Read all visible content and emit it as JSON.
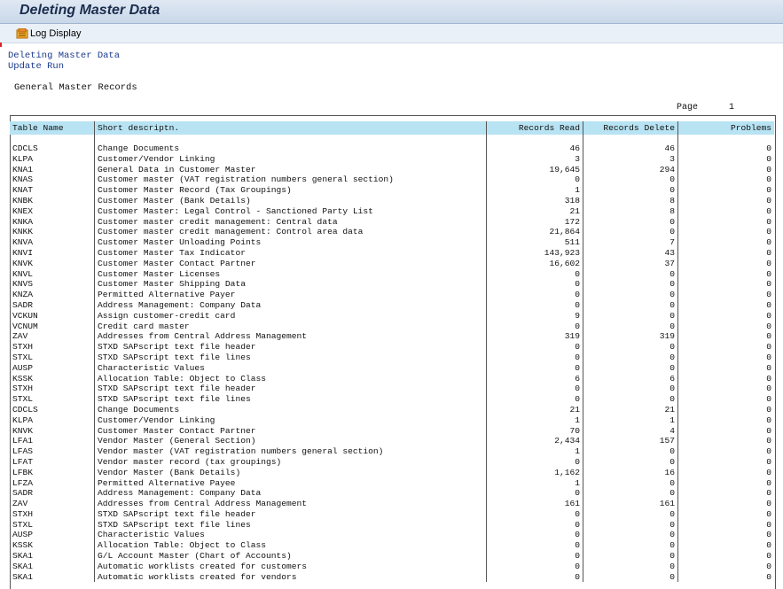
{
  "title": "Deleting Master Data",
  "toolbar": {
    "log_display": "Log Display"
  },
  "header_lines": [
    "Deleting Master Data",
    "Update Run"
  ],
  "section": "General Master Records",
  "page_label": "Page",
  "page_number": "1",
  "columns": [
    "Table Name",
    "Short descriptn.",
    "Records Read",
    "Records Delete",
    "Problems"
  ],
  "rows": [
    [
      "CDCLS",
      "Change Documents",
      "46",
      "46",
      "0"
    ],
    [
      "KLPA",
      "Customer/Vendor Linking",
      "3",
      "3",
      "0"
    ],
    [
      "KNA1",
      "General Data in Customer Master",
      "19,645",
      "294",
      "0"
    ],
    [
      "KNAS",
      "Customer master (VAT registration numbers general section)",
      "0",
      "0",
      "0"
    ],
    [
      "KNAT",
      "Customer Master Record (Tax Groupings)",
      "1",
      "0",
      "0"
    ],
    [
      "KNBK",
      "Customer Master (Bank Details)",
      "318",
      "8",
      "0"
    ],
    [
      "KNEX",
      "Customer Master: Legal Control - Sanctioned Party List",
      "21",
      "8",
      "0"
    ],
    [
      "KNKA",
      "Customer master credit management: Central data",
      "172",
      "0",
      "0"
    ],
    [
      "KNKK",
      "Customer master credit management: Control area data",
      "21,864",
      "0",
      "0"
    ],
    [
      "KNVA",
      "Customer Master Unloading Points",
      "511",
      "7",
      "0"
    ],
    [
      "KNVI",
      "Customer Master Tax Indicator",
      "143,923",
      "43",
      "0"
    ],
    [
      "KNVK",
      "Customer Master Contact Partner",
      "16,602",
      "37",
      "0"
    ],
    [
      "KNVL",
      "Customer Master Licenses",
      "0",
      "0",
      "0"
    ],
    [
      "KNVS",
      "Customer Master Shipping Data",
      "0",
      "0",
      "0"
    ],
    [
      "KNZA",
      "Permitted Alternative Payer",
      "0",
      "0",
      "0"
    ],
    [
      "SADR",
      "Address Management: Company Data",
      "0",
      "0",
      "0"
    ],
    [
      "VCKUN",
      "Assign customer-credit card",
      "9",
      "0",
      "0"
    ],
    [
      "VCNUM",
      "Credit card master",
      "0",
      "0",
      "0"
    ],
    [
      "ZAV",
      "Addresses from Central Address Management",
      "319",
      "319",
      "0"
    ],
    [
      "STXH",
      "STXD SAPscript text file header",
      "0",
      "0",
      "0"
    ],
    [
      "STXL",
      "STXD SAPscript text file lines",
      "0",
      "0",
      "0"
    ],
    [
      "AUSP",
      "Characteristic Values",
      "0",
      "0",
      "0"
    ],
    [
      "KSSK",
      "Allocation Table: Object to Class",
      "6",
      "6",
      "0"
    ],
    [
      "STXH",
      "STXD SAPscript text file header",
      "0",
      "0",
      "0"
    ],
    [
      "STXL",
      "STXD SAPscript text file lines",
      "0",
      "0",
      "0"
    ],
    [
      "CDCLS",
      "Change Documents",
      "21",
      "21",
      "0"
    ],
    [
      "KLPA",
      "Customer/Vendor Linking",
      "1",
      "1",
      "0"
    ],
    [
      "KNVK",
      "Customer Master Contact Partner",
      "70",
      "4",
      "0"
    ],
    [
      "LFA1",
      "Vendor Master (General Section)",
      "2,434",
      "157",
      "0"
    ],
    [
      "LFAS",
      "Vendor master (VAT registration numbers general section)",
      "1",
      "0",
      "0"
    ],
    [
      "LFAT",
      "Vendor master record  (tax groupings)",
      "0",
      "0",
      "0"
    ],
    [
      "LFBK",
      "Vendor Master (Bank Details)",
      "1,162",
      "16",
      "0"
    ],
    [
      "LFZA",
      "Permitted Alternative Payee",
      "1",
      "0",
      "0"
    ],
    [
      "SADR",
      "Address Management: Company Data",
      "0",
      "0",
      "0"
    ],
    [
      "ZAV",
      "Addresses from Central Address Management",
      "161",
      "161",
      "0"
    ],
    [
      "STXH",
      "STXD SAPscript text file header",
      "0",
      "0",
      "0"
    ],
    [
      "STXL",
      "STXD SAPscript text file lines",
      "0",
      "0",
      "0"
    ],
    [
      "AUSP",
      "Characteristic Values",
      "0",
      "0",
      "0"
    ],
    [
      "KSSK",
      "Allocation Table: Object to Class",
      "0",
      "0",
      "0"
    ],
    [
      "SKA1",
      "G/L Account Master (Chart of Accounts)",
      "0",
      "0",
      "0"
    ],
    [
      "SKA1",
      "Automatic worklists created for customers",
      "0",
      "0",
      "0"
    ],
    [
      "SKA1",
      "Automatic worklists created for vendors",
      "0",
      "0",
      "0"
    ]
  ]
}
